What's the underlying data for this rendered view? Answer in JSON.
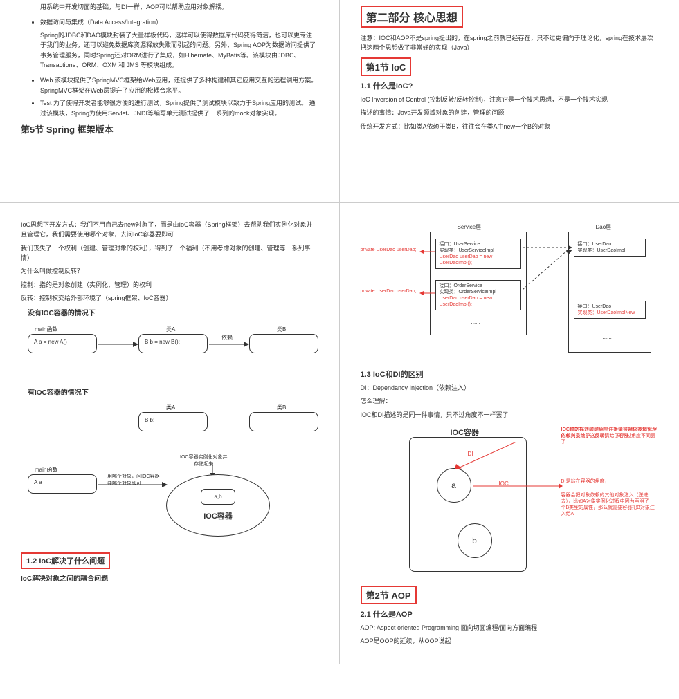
{
  "p1": {
    "intro_tail": "用系统中开发切面的基础，与DI一样，AOP可以帮助应用对象解耦。",
    "li1": "数据访问与集成（Data Access/Integration）",
    "li1_desc": "Spring的JDBC和DAO模块封装了大量样板代码，这样可以使得数据库代码变得简洁，也可以更专注于我们的业务，还可以避免数据库资源释放失败而引起的问题。另外，Spring AOP为数据访问提供了事务管理服务，同时Spring还对ORM进行了集成，如Hibernate、MyBatis等。该模块由JDBC、Transactions、ORM、OXM 和 JMS 等模块组成。",
    "li2": "Web 该模块提供了SpringMVC框架给Web应用，还提供了多种构建和其它应用交互的远程调用方案。 SpringMVC框架在Web层提升了应用的松耦合水平。",
    "li3": "Test 为了使得开发者能够很方便的进行测试，Spring提供了测试模块以致力于Spring应用的测试。 通过该模块，Spring为使用Servlet、JNDI等编写单元测试提供了一系列的mock对象实现。",
    "h_sec5": "第5节 Spring 框架版本"
  },
  "p2": {
    "h_part2": "第二部分 核心思想",
    "note": "注意：IOC和AOP不是spring提出的，在spring之前就已经存在，只不过更偏向于理论化，spring在技术层次把这两个思想做了非常好的实现（Java）",
    "h_sec1": "第1节 IoC",
    "h_1_1": "1.1 什么是IoC?",
    "p1": "IoC Inversion of Control (控制反转/反转控制)，注意它是一个技术思想，不是一个技术实现",
    "p2": "描述的事情：Java开发领域对象的创建，管理的问题",
    "p3": "传统开发方式：比如类A依赖于类B，往往会在类A中new一个B的对象"
  },
  "p3": {
    "p1": "IoC思想下开发方式：我们不用自己去new对象了，而是由IoC容器（Spring框架）去帮助我们实例化对象并且管理它，我们需要使用哪个对象，去问IoC容器要即可",
    "p2": "我们丧失了一个权利（创建、管理对象的权利），得到了一个福利（不用考虑对象的创建、管理等一系列事情）",
    "p3": "为什么叫做控制反转？",
    "p4": "控制：指的是对象创建（实例化、管理）的权利",
    "p5": "反转：控制权交给外部环境了（spring框架、IoC容器）",
    "d1_title": "没有IOC容器的情况下",
    "d1_main": "main函数",
    "d1_a": "A  a = new A()",
    "d1_classA": "类A",
    "d1_b": "B b = new B();",
    "d1_dep": "依赖",
    "d1_classB": "类B",
    "d2_title": "有IOC容器的情况下",
    "d2_main": "main函数",
    "d2_aa": "A a",
    "d2_note": "用哪个对象，问IOC容器\n要哪个对象即可",
    "d2_classA": "类A",
    "d2_bb": "B b;",
    "d2_classB": "类B",
    "d2_ioctext": "IOC容器实例化对象并\n存储起来",
    "d2_ab": "a,b",
    "d2_container": "IOC容器",
    "h_1_2": "1.2 IoC解决了什么问题",
    "h_1_2_sub": "IoC解决对象之间的耦合问题"
  },
  "p4": {
    "svc_layer": "Service层",
    "dao_layer": "Dao层",
    "priv": "private UserDao userDao;",
    "box1_l1": "接口：UserService",
    "box1_l2": "实现类：UserServiceImpl",
    "box1_l3": "UserDao userDao = new UserDaoImpl();",
    "box2_l1": "接口：OrderService",
    "box2_l2": "实现类：OrderServiceImpl",
    "box2_l3": "UserDao userDao = new UserDaoImpl();",
    "box3_l1": "接口：UserDao",
    "box3_l2": "实现类：UserDaoImpl",
    "box4_l1": "接口：UserDao",
    "box4_l2": "实现类：UserDaoImplNew",
    "dots": "......",
    "h_1_3": "1.3 IoC和DI的区别",
    "p_di": "DI：Dependancy Injection（依赖注入）",
    "p_how": "怎么理解：",
    "p_same": "IOC和DI描述的是同一件事情，只不过角度不一样罢了",
    "d2_title": "IOC容器",
    "d2_di": "DI",
    "d2_ioc": "IOC",
    "d2_a": "a",
    "d2_b": "b",
    "note1": "IOC和DI描述的是同一件事情（对象实例化及依赖关系维护这件事情），只不过角度不同罢了",
    "note2": "IOC是站在对象的角度，对象实例化及其管理的权利交给了（反转）给了容器",
    "note3": "DI是站在容器的角度，",
    "note4": "容器会把对象依赖的其他对象注入（送进去），比如A对象实例化过程中因为声明了一个B类型的属性，那么就需要容器把B对象注入给A",
    "h_sec2": "第2节 AOP",
    "h_2_1": "2.1 什么是AOP",
    "p_aop1": "AOP: Aspect oriented Programming 面向切面编程/面向方面编程",
    "p_aop2": "AOP是OOP的延续，从OOP说起"
  }
}
